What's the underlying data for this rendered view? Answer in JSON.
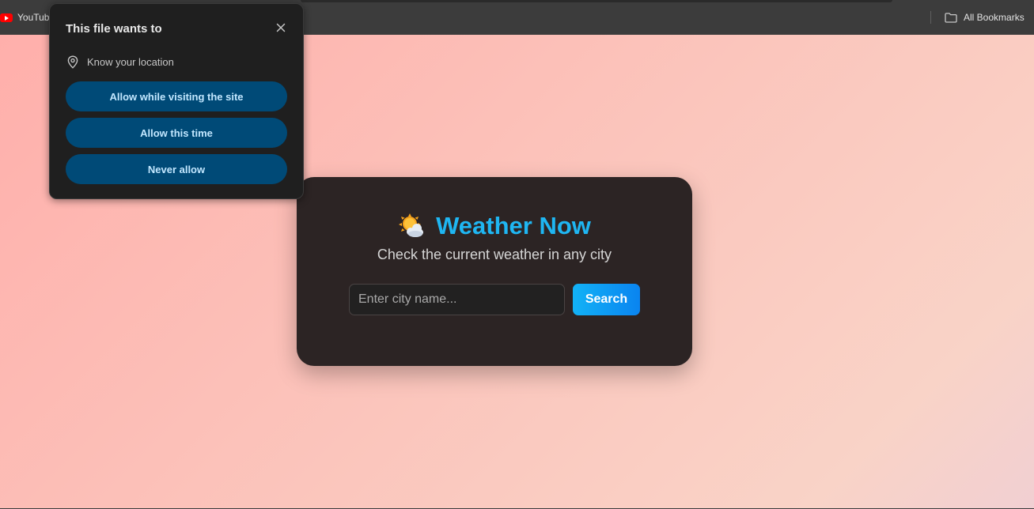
{
  "bookmarks_bar": {
    "youtube_label": "YouTube",
    "all_bookmarks_label": "All Bookmarks"
  },
  "permission_popup": {
    "title": "This file wants to",
    "permission": "Know your location",
    "buttons": [
      "Allow while visiting the site",
      "Allow this time",
      "Never allow"
    ],
    "button_color": "#004a77",
    "button_text_color": "#c2e7ff"
  },
  "weather_app": {
    "title": "Weather Now",
    "icon": "sun-behind-cloud-icon",
    "subtitle": "Check the current weather in any city",
    "input_placeholder": "Enter city name...",
    "search_label": "Search",
    "accent_color": "#1fb6f2",
    "card_color": "#2c2424"
  }
}
